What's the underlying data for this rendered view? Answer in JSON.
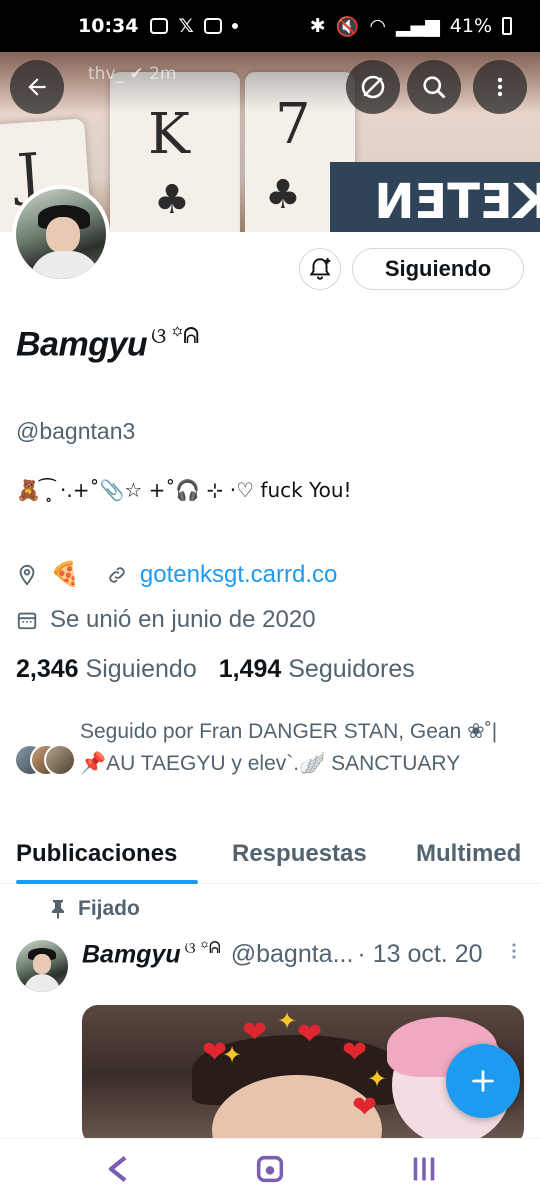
{
  "status_bar": {
    "time": "10:34",
    "battery": "41%"
  },
  "banner": {
    "ghost_user": "thv_",
    "ghost_time": "2m",
    "card_letters": [
      "J",
      "K",
      "7"
    ],
    "sign_text": "KETEN"
  },
  "profile": {
    "display_name": "Bamgyu",
    "name_decoration": "ଓ ꙳ᕱ",
    "handle": "@bagntan3",
    "bio": "🧸 ͡ ̥ ·.+˚📎☆ +˚🎧 ⊹ ·♡ fuck You!",
    "location": "🍕",
    "website": "gotenksgt.carrd.co",
    "joined": "Se unió en junio de 2020",
    "following_count": "2,346",
    "following_label": "Siguiendo",
    "followers_count": "1,494",
    "followers_label": "Seguidores",
    "followed_by": "Seguido por Fran DANGER STAN, Gean ❀˚| 📌AU TAEGYU y elev`.🪽 SANCTUARY"
  },
  "actions": {
    "follow_button": "Siguiendo"
  },
  "tabs": [
    {
      "label": "Publicaciones",
      "active": true
    },
    {
      "label": "Respuestas",
      "active": false
    },
    {
      "label": "Multimed",
      "active": false
    }
  ],
  "post": {
    "pinned_label": "Fijado",
    "author_name": "Bamgyu",
    "author_decoration": "ଓ ꙳ᕱ",
    "author_handle": "@bagnta...",
    "date": "· 13 oct. 20"
  },
  "colors": {
    "accent": "#1d9bf0",
    "text": "#0f1419",
    "muted": "#536471"
  },
  "icons": [
    "back-arrow-icon",
    "hide-icon",
    "search-icon",
    "more-vertical-icon",
    "bell-plus-icon",
    "location-icon",
    "link-icon",
    "calendar-icon",
    "pin-icon",
    "compose-plus-icon"
  ]
}
